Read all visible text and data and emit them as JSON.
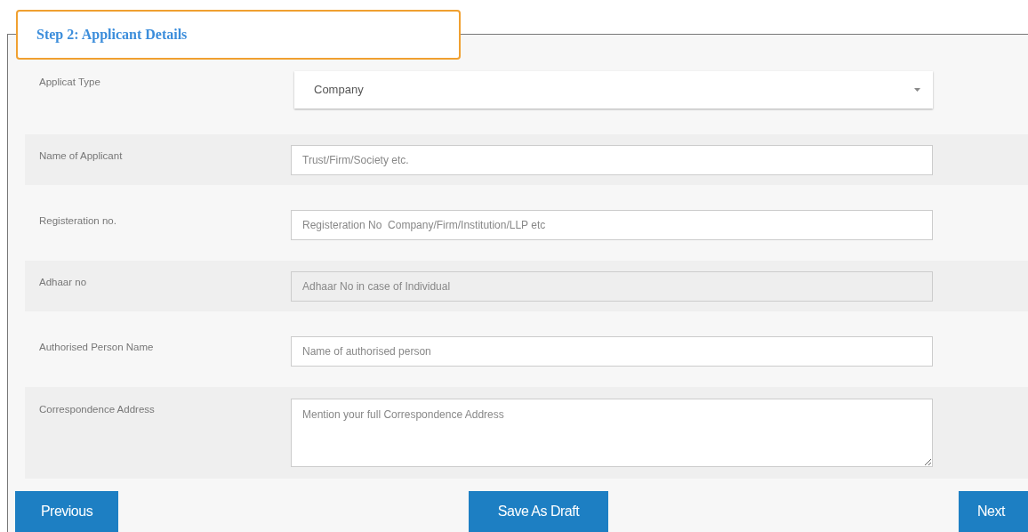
{
  "section": {
    "title": "Step 2: Applicant Details"
  },
  "fields": [
    {
      "kind": "select",
      "label": "Applicat Type",
      "value": "Company"
    },
    {
      "kind": "input",
      "label": "Name of Applicant",
      "placeholder": "Trust/Firm/Society etc.",
      "disabled": false
    },
    {
      "kind": "input",
      "label": "Registeration no.",
      "placeholder": "Registeration No  Company/Firm/Institution/LLP etc",
      "disabled": false
    },
    {
      "kind": "input",
      "label": "Adhaar no",
      "placeholder": "Adhaar No in case of Individual",
      "disabled": true
    },
    {
      "kind": "input",
      "label": "Authorised Person Name",
      "placeholder": "Name of authorised person",
      "disabled": false
    },
    {
      "kind": "textarea",
      "label": "Correspondence Address",
      "placeholder": "Mention your full Correspondence Address",
      "disabled": false
    }
  ],
  "buttons": [
    "Previous",
    "Save As Draft",
    "Next"
  ]
}
